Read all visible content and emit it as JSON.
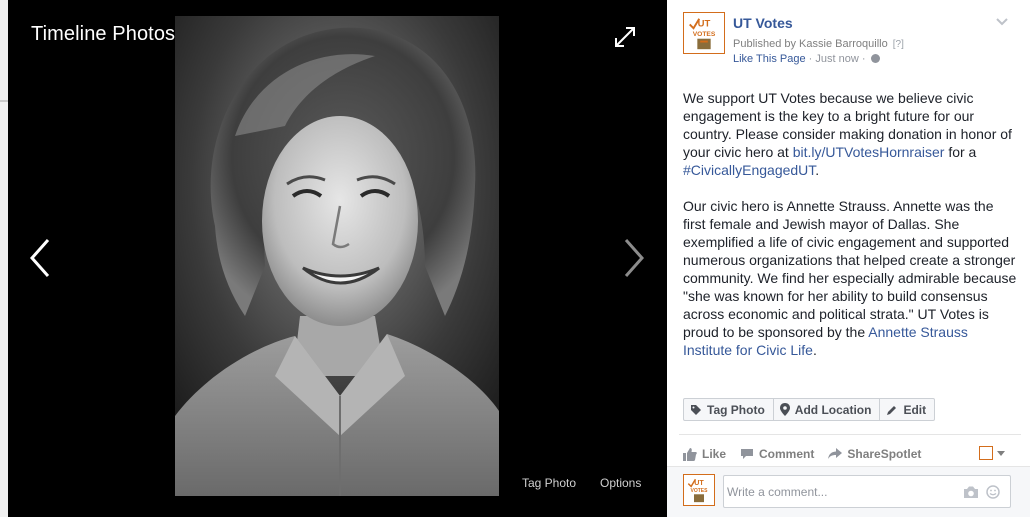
{
  "viewer": {
    "title": "Timeline Photos",
    "tag_photo_label": "Tag Photo",
    "options_label": "Options",
    "icons": {
      "fullscreen": "fullscreen-expand-icon",
      "prev": "chevron-left-icon",
      "next": "chevron-right-icon"
    }
  },
  "post": {
    "page_name": "UT Votes",
    "avatar_text": "UT VOTES",
    "published_prefix": "Published by Kassie Barroquillo",
    "published_hint": "[?]",
    "like_page": "Like This Page",
    "separator": " · ",
    "time": "Just now",
    "separator2": " · ",
    "paragraph1_text": "We support UT Votes because we believe civic engagement is the key to a bright future for our country. Please consider making donation in honor of your civic hero at ",
    "paragraph1_link": "bit.ly/UTVotesHornraiser",
    "paragraph1_mid": " for a ",
    "paragraph1_hashtag": "#CivicallyEngagedUT",
    "paragraph1_end": ".",
    "paragraph2_text": "Our civic hero is Annette Strauss. Annette was the first female and Jewish mayor of Dallas. She exemplified a life of civic engagement and supported numerous organizations that helped create a stronger community. We find her especially admirable because \"she was known for her ability to build consensus across economic and political strata.\" UT Votes is proud to be sponsored by the ",
    "paragraph2_link": "Annette Strauss Institute for Civic Life",
    "paragraph2_end": "."
  },
  "actions": {
    "tag_photo": "Tag Photo",
    "add_location": "Add Location",
    "edit": "Edit"
  },
  "reactions": {
    "like": "Like",
    "comment": "Comment",
    "share": "Share",
    "spotlight": "Spotlet"
  },
  "comment": {
    "placeholder": "Write a comment..."
  },
  "colors": {
    "link": "#365899",
    "brand_orange": "#d36d1b",
    "text": "#1d2129",
    "muted": "#90949c"
  }
}
